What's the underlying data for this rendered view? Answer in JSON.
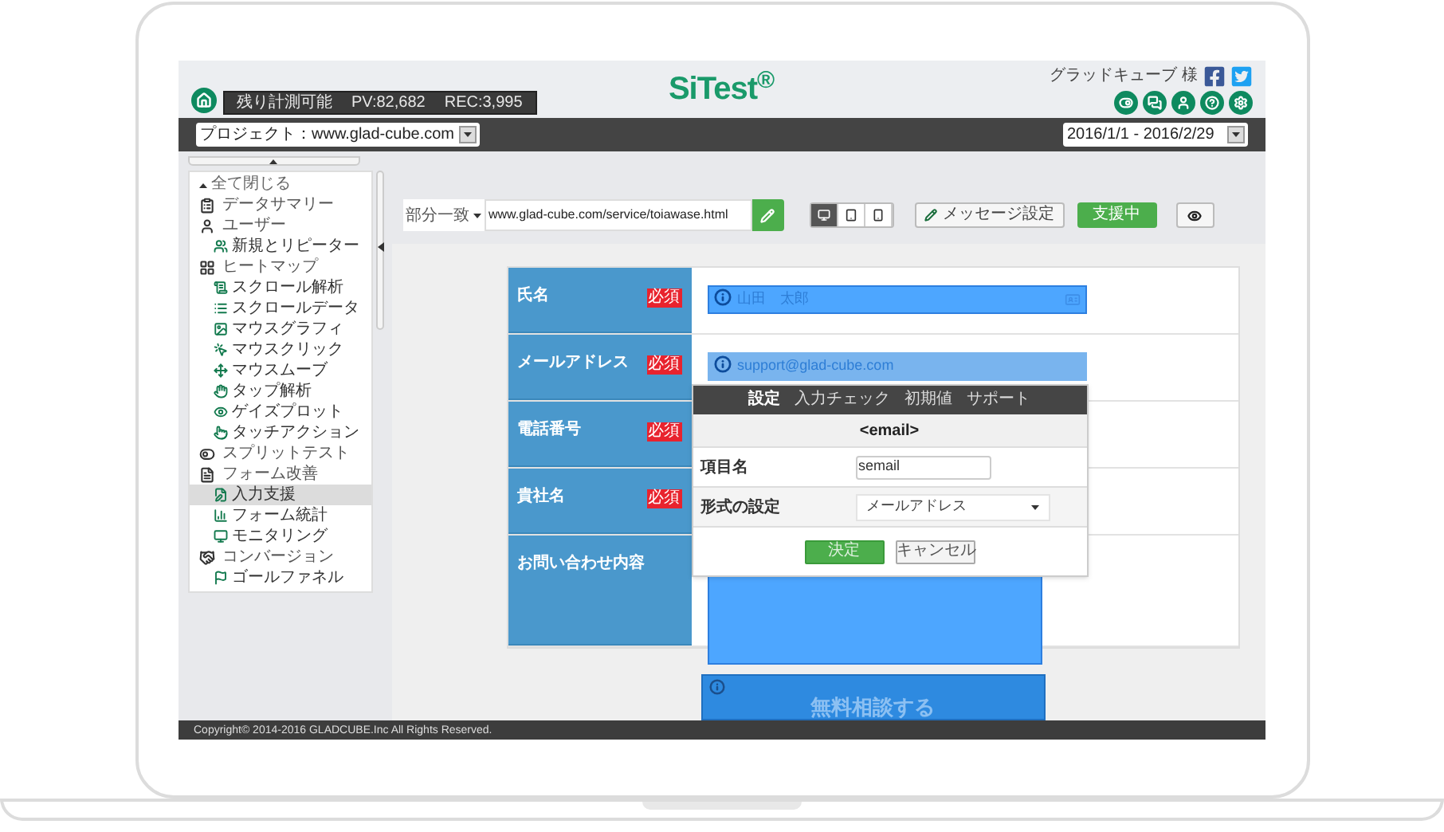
{
  "header": {
    "stats": [
      "残り計測可能",
      "PV:82,682",
      "REC:3,995"
    ],
    "logo": "SiTest$^{®}$",
    "user": "グラッドキューブ 様"
  },
  "project_select": {
    "value": "プロジェクト：www.glad-cube.com"
  },
  "date_select": {
    "value": "2016/1/1 - 2016/2/29"
  },
  "sidebar": {
    "collapse_all": "全て閉じる",
    "items": [
      {
        "label": "データサマリー",
        "selected": false
      },
      {
        "label": "ユーザー",
        "selected": false,
        "children": [
          {
            "label": "新規とリピーター",
            "selected": false
          }
        ]
      },
      {
        "label": "ヒートマップ",
        "selected": false,
        "children": [
          {
            "label": "スクロール解析",
            "selected": false
          },
          {
            "label": "スクロールデータ",
            "selected": false
          },
          {
            "label": "マウスグラフィ",
            "selected": false
          },
          {
            "label": "マウスクリック",
            "selected": false
          },
          {
            "label": "マウスムーブ",
            "selected": false
          },
          {
            "label": "タップ解析",
            "selected": false
          },
          {
            "label": "ゲイズプロット",
            "selected": false
          },
          {
            "label": "タッチアクション",
            "selected": false
          }
        ]
      },
      {
        "label": "スプリットテスト",
        "selected": false
      },
      {
        "label": "フォーム改善",
        "selected": false,
        "children": [
          {
            "label": "入力支援",
            "selected": true
          },
          {
            "label": "フォーム統計",
            "selected": false
          },
          {
            "label": "モニタリング",
            "selected": false
          }
        ]
      },
      {
        "label": "コンバージョン",
        "selected": false,
        "children": [
          {
            "label": "ゴールファネル",
            "selected": false
          }
        ]
      }
    ]
  },
  "toolbar": {
    "match_select": "部分一致",
    "url": "www.glad-cube.com/service/toiawase.html",
    "devices": [
      {
        "kind": "desktop",
        "selected": true
      },
      {
        "kind": "tablet",
        "selected": false
      },
      {
        "kind": "phone",
        "selected": false
      }
    ],
    "message_button": "メッセージ設定",
    "status_button": "支援中"
  },
  "form": {
    "rows": [
      {
        "label": "氏名",
        "required": true,
        "badge": "必須",
        "field": {
          "kind": "input",
          "placeholder": "山田　太郎",
          "active": false
        }
      },
      {
        "label": "メールアドレス",
        "required": true,
        "badge": "必須",
        "field": {
          "kind": "input",
          "placeholder": "support@glad-cube.com",
          "active": true
        }
      },
      {
        "label": "電話番号",
        "required": true,
        "badge": "必須"
      },
      {
        "label": "貴社名",
        "required": true,
        "badge": "必須"
      },
      {
        "label": "お問い合わせ内容",
        "required": false,
        "field": {
          "kind": "textarea",
          "active": false
        }
      }
    ],
    "submit_button": "無料相談する"
  },
  "popup": {
    "tabs": [
      {
        "label": "設定",
        "selected": true
      },
      {
        "label": "入力チェック",
        "selected": false
      },
      {
        "label": "初期値",
        "selected": false
      },
      {
        "label": "サポート",
        "selected": false
      }
    ],
    "title": "<email>",
    "fields": [
      {
        "kind": "input",
        "label": "項目名",
        "value": "semail"
      },
      {
        "kind": "select",
        "label": "形式の設定",
        "value": "メールアドレス"
      }
    ],
    "buttons": [
      {
        "label": "決定",
        "kind": "primary"
      },
      {
        "label": "キャンセル",
        "kind": "secondary"
      }
    ]
  },
  "footer": "Copyright© 2014-2016 GLADCUBE.Inc All Rights Reserved."
}
